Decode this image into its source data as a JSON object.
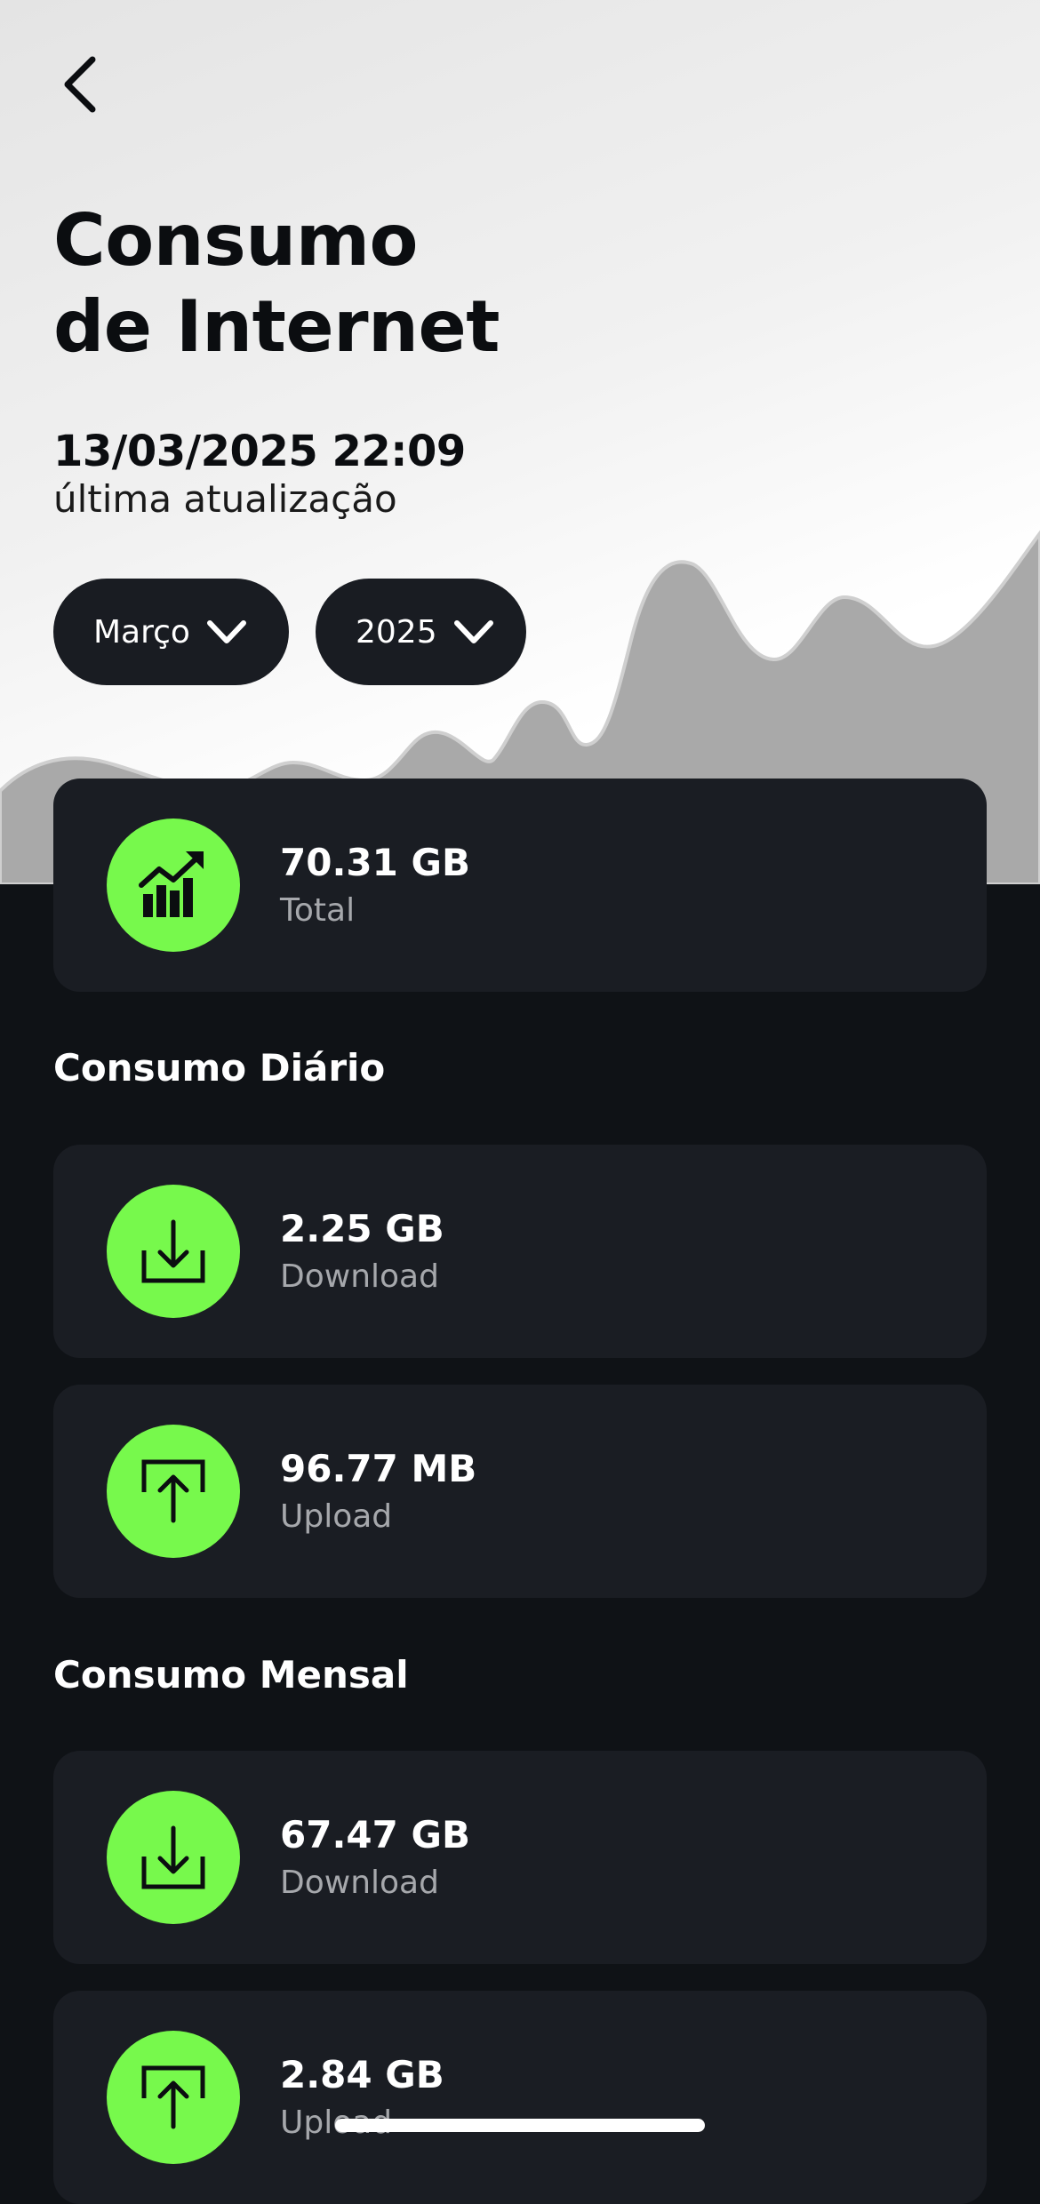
{
  "header": {
    "title": "Consumo\nde Internet",
    "last_update_time": "13/03/2025 22:09",
    "last_update_label": "última atualização"
  },
  "filters": {
    "month": "Março",
    "year": "2025"
  },
  "total": {
    "value": "70.31 GB",
    "label": "Total"
  },
  "daily": {
    "title": "Consumo Diário",
    "download": {
      "value": "2.25 GB",
      "label": "Download"
    },
    "upload": {
      "value": "96.77 MB",
      "label": "Upload"
    }
  },
  "monthly": {
    "title": "Consumo Mensal",
    "download": {
      "value": "67.47 GB",
      "label": "Download"
    },
    "upload": {
      "value": "2.84 GB",
      "label": "Upload"
    }
  },
  "colors": {
    "accent": "#77f94c",
    "card": "#1a1d23",
    "background": "#0f1216",
    "pill": "#191c22"
  },
  "icons": {
    "back": "chevron-left-icon",
    "dropdown": "chevron-down-icon",
    "total": "growth-chart-icon",
    "download": "download-tray-icon",
    "upload": "upload-tray-icon"
  }
}
